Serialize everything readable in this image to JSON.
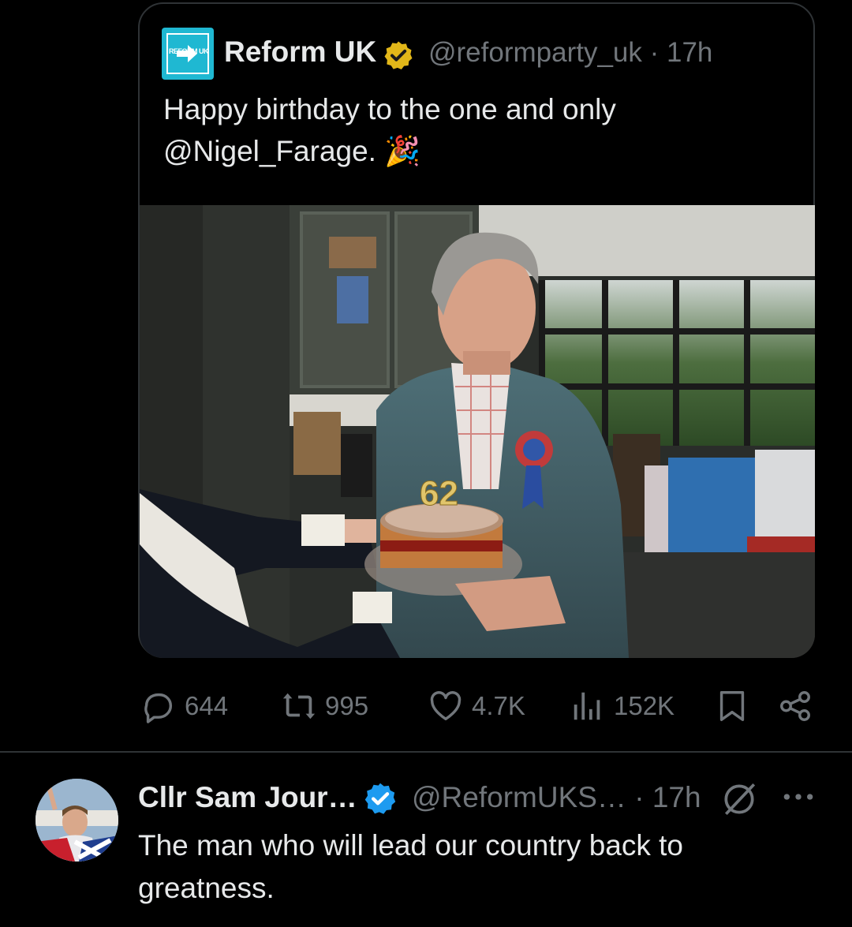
{
  "quote_tweet": {
    "author_name": "Reform UK",
    "handle_time": "@reformparty_uk · 17h",
    "logo_text": "REFORM\nUK",
    "text_line1": "Happy birthday to the one and only",
    "text_line2": "@Nigel_Farage. 🎉",
    "cake_candle_text": "62"
  },
  "actions": {
    "replies": "644",
    "reposts": "995",
    "likes": "4.7K",
    "views": "152K"
  },
  "reply": {
    "author_name": "Cllr Sam Jour…",
    "handle_time": "@ReformUKS… · 17h",
    "text": "The man who will lead our country back to greatness."
  },
  "colors": {
    "background": "#000000",
    "text": "#e7e9ea",
    "muted": "#71767b",
    "verified_gold": "#e2b719",
    "verified_blue": "#1d9bf0",
    "reform_brand": "#1fb8d2"
  },
  "icons": [
    "reply-icon",
    "repost-icon",
    "like-icon",
    "views-icon",
    "bookmark-icon",
    "share-icon",
    "grok-icon",
    "more-icon",
    "verified-badge-icon"
  ]
}
